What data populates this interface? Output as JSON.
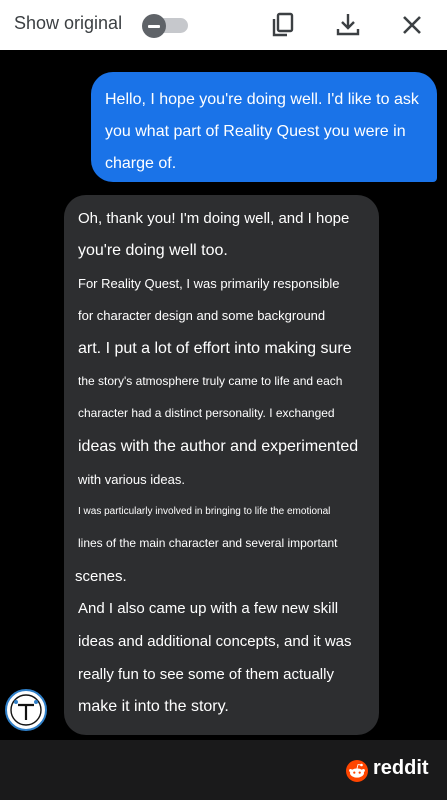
{
  "toolbar": {
    "show_original_label": "Show original",
    "toggle_state": "off"
  },
  "icons": {
    "copy": "copy-icon",
    "download": "download-icon",
    "close": "close-icon",
    "avatar": "avatar-icon",
    "reddit_logo": "reddit-logo-icon"
  },
  "user_message": {
    "lines": [
      "Hello, I hope you're doing well. I'd like to ask",
      "you what part of Reality Quest you were in",
      "charge of."
    ]
  },
  "reply": {
    "lines": [
      "Oh, thank you! I'm doing well, and I hope",
      "you're doing well too.",
      "For Reality Quest, I was primarily responsible",
      "for character design and some background",
      "art. I put a lot of effort into making sure",
      "the story's atmosphere truly came to life and each",
      "character had a distinct personality. I exchanged",
      "ideas with the author and experimented",
      "with various ideas.",
      "I was particularly involved in bringing to life the emotional",
      "lines of the main character and several important",
      "scenes.",
      "And I also came up with a few new skill",
      "ideas and additional concepts, and it was",
      "really fun to see some of them actually",
      "make it into the story."
    ]
  },
  "footer": {
    "brand": "reddit"
  },
  "colors": {
    "user_bubble": "#1a73e8",
    "reply_bubble": "#2d2e30",
    "reddit_orange": "#ff4500"
  }
}
